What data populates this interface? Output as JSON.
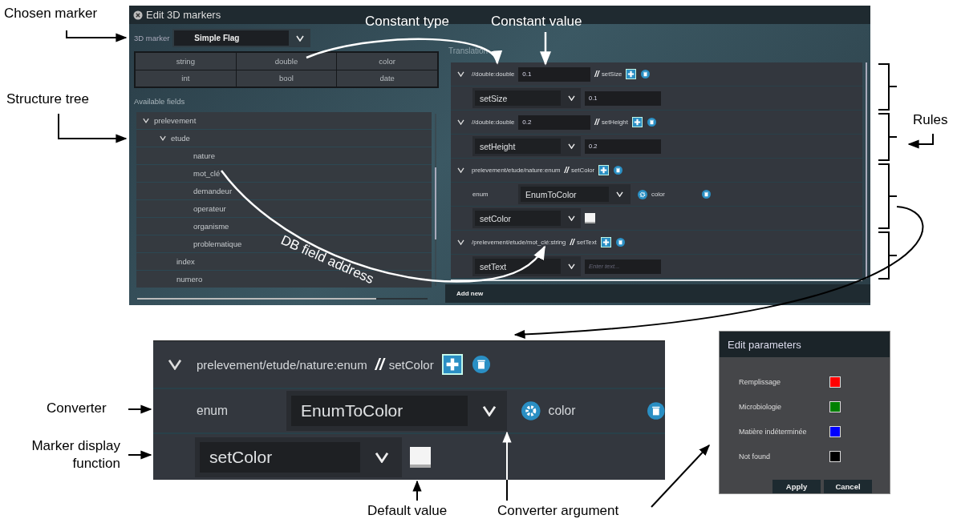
{
  "window": {
    "title": "Edit 3D markers"
  },
  "marker": {
    "label": "3D marker",
    "value": "Simple Flag"
  },
  "constant_types": [
    "string",
    "double",
    "color",
    "int",
    "bool",
    "date"
  ],
  "fields": {
    "label": "Available fields",
    "tree": [
      {
        "label": "prelevement",
        "expanded": true,
        "children": [
          {
            "label": "etude",
            "expanded": true,
            "children": [
              {
                "label": "nature"
              },
              {
                "label": "mot_clé"
              },
              {
                "label": "demandeur"
              },
              {
                "label": "operateur"
              },
              {
                "label": "organisme"
              },
              {
                "label": "problematique"
              }
            ]
          },
          {
            "label": "index"
          },
          {
            "label": "numero"
          }
        ]
      }
    ]
  },
  "translation": {
    "label": "Translation",
    "add_new": "Add new",
    "rules": [
      {
        "path": "//double:double",
        "value": "0.1",
        "separator": "//",
        "function": "setSize",
        "expanded": true,
        "children": [
          {
            "kind": "value",
            "select": "setSize",
            "value": "0.1"
          }
        ]
      },
      {
        "path": "//double:double",
        "value": "0.2",
        "separator": "//",
        "function": "setHeight",
        "expanded": true,
        "children": [
          {
            "kind": "value",
            "select": "setHeight",
            "value": "0.2"
          }
        ]
      },
      {
        "path": "prelevement/etude/nature:enum",
        "separator": "//",
        "function": "setColor",
        "expanded": true,
        "children": [
          {
            "kind": "converter",
            "label": "enum",
            "select": "EnumToColor",
            "argument": "color"
          },
          {
            "kind": "color",
            "select": "setColor"
          }
        ]
      },
      {
        "path": "/prelevement/etude/mot_clé:string",
        "separator": "//",
        "function": "setText",
        "expanded": true,
        "children": [
          {
            "kind": "value",
            "select": "setText",
            "placeholder": "Enter text..."
          }
        ]
      }
    ]
  },
  "detail": {
    "path": "prelevement/etude/nature:enum",
    "separator": "//",
    "function": "setColor",
    "expanded": true,
    "children": [
      {
        "kind": "converter",
        "label": "enum",
        "select": "EnumToColor",
        "argument": "color"
      },
      {
        "kind": "color",
        "select": "setColor"
      }
    ]
  },
  "parameters": {
    "title": "Edit parameters",
    "items": [
      {
        "label": "Remplissage",
        "color": "#ff0000"
      },
      {
        "label": "Microbiologie",
        "color": "#008000"
      },
      {
        "label": "Matière indéterminée",
        "color": "#0000ff"
      },
      {
        "label": "Not found",
        "color": "#000000"
      }
    ],
    "buttons": [
      "Apply",
      "Cancel"
    ]
  },
  "annotations": [
    "Chosen marker",
    "Constant type",
    "Constant value",
    "Structure tree",
    "Rules",
    "DB field address",
    "Converter",
    "Marker display function",
    "Default value",
    "Converter argument"
  ]
}
